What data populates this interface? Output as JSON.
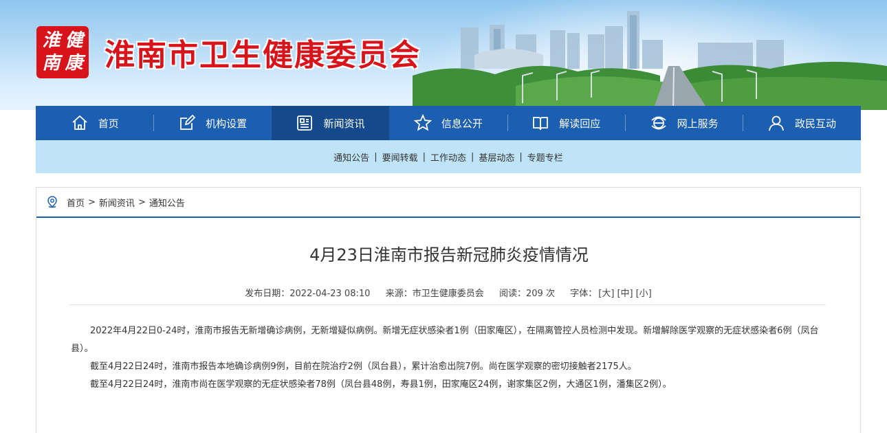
{
  "site": {
    "seal_chars": [
      "健",
      "淮",
      "康",
      "南"
    ],
    "title": "淮南市卫生健康委员会"
  },
  "nav": {
    "items": [
      {
        "label": "首页",
        "icon": "home-icon"
      },
      {
        "label": "机构设置",
        "icon": "edit-icon"
      },
      {
        "label": "新闻资讯",
        "icon": "news-icon"
      },
      {
        "label": "信息公开",
        "icon": "star-icon"
      },
      {
        "label": "解读回应",
        "icon": "book-icon"
      },
      {
        "label": "网上服务",
        "icon": "globe-icon"
      },
      {
        "label": "政民互动",
        "icon": "user-icon"
      }
    ],
    "active_index": 2
  },
  "subnav": {
    "items": [
      "通知公告",
      "要闻转载",
      "工作动态",
      "基层动态",
      "专题专栏"
    ],
    "separator": "|"
  },
  "breadcrumb": {
    "items": [
      "首页",
      "新闻资讯",
      "通知公告"
    ],
    "separator": ">"
  },
  "article": {
    "title": "4月23日淮南市报告新冠肺炎疫情情况",
    "meta": {
      "date_label": "发布日期：",
      "date": "2022-04-23 08:10",
      "source_label": "来源：",
      "source": "市卫生健康委员会",
      "views_label": "阅读：",
      "views": "209",
      "views_unit": "次",
      "font_label": "字体：",
      "font_large": "[大]",
      "font_medium": "[中]",
      "font_small": "[小]"
    },
    "paragraphs": [
      "2022年4月22日0-24时，淮南市报告无新增确诊病例，无新增疑似病例。新增无症状感染者1例（田家庵区），在隔离管控人员检测中发现。新增解除医学观察的无症状感染者6例（凤台县）。",
      "截至4月22日24时，淮南市报告本地确诊病例9例，目前在院治疗2例（凤台县），累计治愈出院7例。尚在医学观察的密切接触者2175人。",
      "截至4月22日24时，淮南市尚在医学观察的无症状感染者78例（凤台县48例，寿县1例，田家庵区24例，谢家集区2例，大通区1例，潘集区2例）。"
    ]
  },
  "colors": {
    "brand_red": "#d7141b",
    "nav_blue": "#1c5fb0",
    "nav_active": "#14498b",
    "subnav_bg": "#bfe3f7"
  }
}
